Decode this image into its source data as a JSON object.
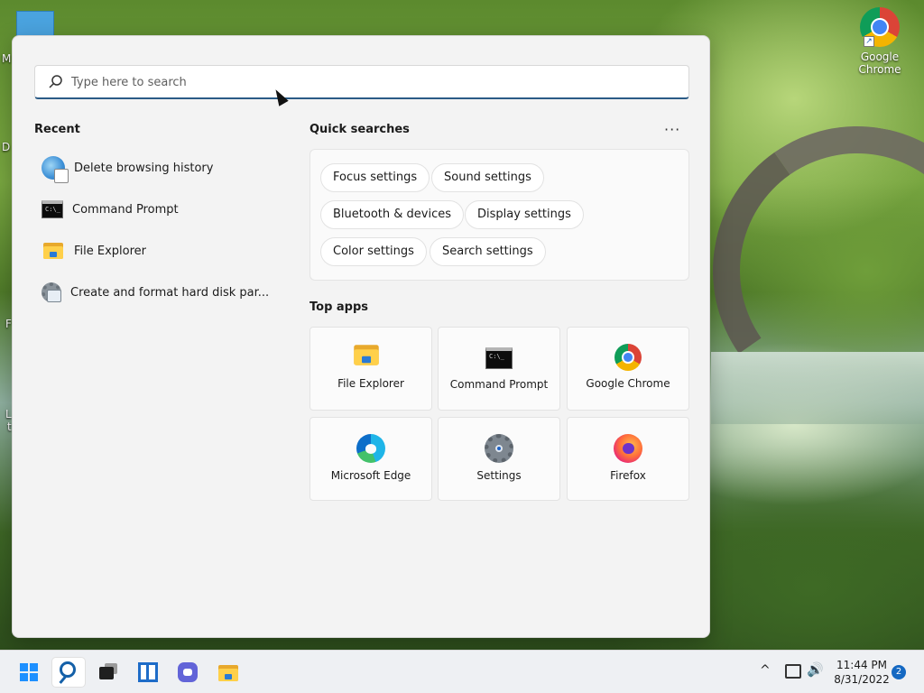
{
  "desktop": {
    "icons": [
      {
        "name": "google-chrome",
        "label_line1": "Google",
        "label_line2": "Chrome"
      }
    ],
    "left_fragments": [
      "M",
      "D",
      "F",
      "L",
      "t"
    ]
  },
  "search": {
    "placeholder": "Type here to search"
  },
  "recent": {
    "title": "Recent",
    "items": [
      {
        "label": "Delete browsing history",
        "icon": "globe-settings-icon"
      },
      {
        "label": "Command Prompt",
        "icon": "command-prompt-icon"
      },
      {
        "label": "File Explorer",
        "icon": "folder-icon"
      },
      {
        "label": "Create and format hard disk par...",
        "icon": "disk-management-icon"
      }
    ]
  },
  "quick_searches": {
    "title": "Quick searches",
    "more": "···",
    "chips": [
      "Focus settings",
      "Sound settings",
      "Bluetooth & devices",
      "Display settings",
      "Color settings",
      "Search settings"
    ]
  },
  "top_apps": {
    "title": "Top apps",
    "apps": [
      {
        "label": "File Explorer",
        "icon": "folder-icon"
      },
      {
        "label": "Command Prompt",
        "icon": "command-prompt-icon"
      },
      {
        "label": "Google Chrome",
        "icon": "chrome-icon"
      },
      {
        "label": "Microsoft Edge",
        "icon": "edge-icon"
      },
      {
        "label": "Settings",
        "icon": "gear-icon"
      },
      {
        "label": "Firefox",
        "icon": "firefox-icon"
      }
    ]
  },
  "taskbar": {
    "clock_time": "11:44 PM",
    "clock_date": "8/31/2022",
    "notification_count": "2",
    "chevron": "^",
    "volume": "🔊"
  },
  "colors": {
    "accent": "#1e90ff",
    "search_underline": "#2b5b86",
    "panel_bg": "#f3f3f3"
  }
}
